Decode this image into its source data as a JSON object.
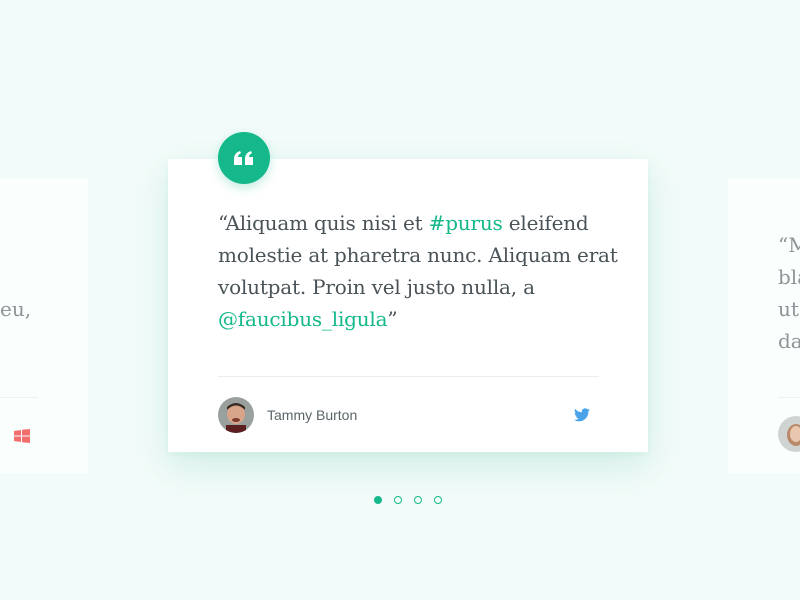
{
  "colors": {
    "accent": "#14b88a",
    "background": "#f2fbf9",
    "twitter": "#4aa3e8",
    "windows": "#f26d6d"
  },
  "left_card": {
    "lines": [
      "eu,"
    ],
    "icon": "windows-icon"
  },
  "main_card": {
    "quote_icon": "quote-icon",
    "quote": {
      "t1": "“Aliquam quis nisi et ",
      "hashtag": "#purus",
      "t2": " eleifend molestie at pharetra nunc. Aliquam erat volutpat. Proin vel justo nulla, a ",
      "mention": "@faucibus_ligula",
      "t3": "”"
    },
    "author": {
      "name": "Tammy Burton",
      "avatar": "avatar-photo"
    },
    "source_icon": "twitter-icon"
  },
  "right_card": {
    "lines": [
      "“M",
      "bla",
      "ut",
      "da"
    ],
    "avatar": "avatar-photo"
  },
  "pagination": {
    "count": 4,
    "active": 0
  }
}
